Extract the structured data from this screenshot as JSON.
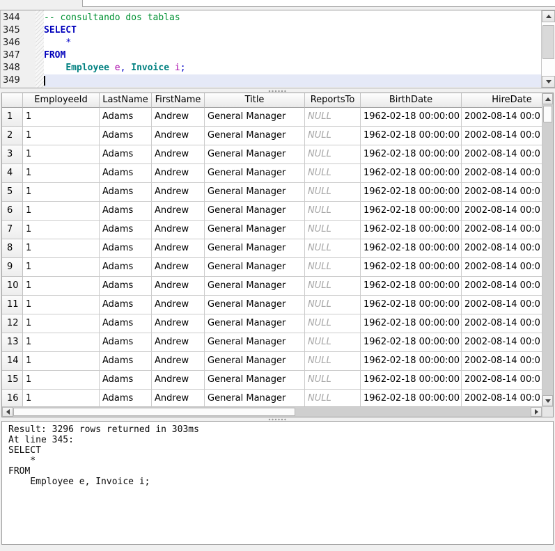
{
  "editor": {
    "lines": [
      {
        "number": "344",
        "tokens": [
          {
            "text": "-- consultando dos tablas",
            "type": "comment"
          }
        ]
      },
      {
        "number": "345",
        "tokens": [
          {
            "text": "SELECT",
            "type": "keyword"
          }
        ]
      },
      {
        "number": "346",
        "tokens": [
          {
            "text": "    ",
            "type": "plain"
          },
          {
            "text": "*",
            "type": "operator"
          }
        ]
      },
      {
        "number": "347",
        "tokens": [
          {
            "text": "FROM",
            "type": "keyword"
          }
        ]
      },
      {
        "number": "348",
        "tokens": [
          {
            "text": "    ",
            "type": "plain"
          },
          {
            "text": "Employee",
            "type": "table"
          },
          {
            "text": " ",
            "type": "plain"
          },
          {
            "text": "e",
            "type": "alias"
          },
          {
            "text": ",",
            "type": "operator"
          },
          {
            "text": " ",
            "type": "plain"
          },
          {
            "text": "Invoice",
            "type": "table"
          },
          {
            "text": " ",
            "type": "plain"
          },
          {
            "text": "i",
            "type": "alias"
          },
          {
            "text": ";",
            "type": "operator"
          }
        ]
      },
      {
        "number": "349",
        "tokens": [],
        "current": true,
        "cursor": true
      }
    ]
  },
  "results": {
    "columns": [
      "EmployeeId",
      "LastName",
      "FirstName",
      "Title",
      "ReportsTo",
      "BirthDate",
      "HireDate"
    ],
    "rows": [
      {
        "num": "1",
        "cells": [
          "1",
          "Adams",
          "Andrew",
          "General Manager",
          "NULL",
          "1962-02-18 00:00:00",
          "2002-08-14 00:0"
        ]
      },
      {
        "num": "2",
        "cells": [
          "1",
          "Adams",
          "Andrew",
          "General Manager",
          "NULL",
          "1962-02-18 00:00:00",
          "2002-08-14 00:0"
        ]
      },
      {
        "num": "3",
        "cells": [
          "1",
          "Adams",
          "Andrew",
          "General Manager",
          "NULL",
          "1962-02-18 00:00:00",
          "2002-08-14 00:0"
        ]
      },
      {
        "num": "4",
        "cells": [
          "1",
          "Adams",
          "Andrew",
          "General Manager",
          "NULL",
          "1962-02-18 00:00:00",
          "2002-08-14 00:0"
        ]
      },
      {
        "num": "5",
        "cells": [
          "1",
          "Adams",
          "Andrew",
          "General Manager",
          "NULL",
          "1962-02-18 00:00:00",
          "2002-08-14 00:0"
        ]
      },
      {
        "num": "6",
        "cells": [
          "1",
          "Adams",
          "Andrew",
          "General Manager",
          "NULL",
          "1962-02-18 00:00:00",
          "2002-08-14 00:0"
        ]
      },
      {
        "num": "7",
        "cells": [
          "1",
          "Adams",
          "Andrew",
          "General Manager",
          "NULL",
          "1962-02-18 00:00:00",
          "2002-08-14 00:0"
        ]
      },
      {
        "num": "8",
        "cells": [
          "1",
          "Adams",
          "Andrew",
          "General Manager",
          "NULL",
          "1962-02-18 00:00:00",
          "2002-08-14 00:0"
        ]
      },
      {
        "num": "9",
        "cells": [
          "1",
          "Adams",
          "Andrew",
          "General Manager",
          "NULL",
          "1962-02-18 00:00:00",
          "2002-08-14 00:0"
        ]
      },
      {
        "num": "10",
        "cells": [
          "1",
          "Adams",
          "Andrew",
          "General Manager",
          "NULL",
          "1962-02-18 00:00:00",
          "2002-08-14 00:0"
        ]
      },
      {
        "num": "11",
        "cells": [
          "1",
          "Adams",
          "Andrew",
          "General Manager",
          "NULL",
          "1962-02-18 00:00:00",
          "2002-08-14 00:0"
        ]
      },
      {
        "num": "12",
        "cells": [
          "1",
          "Adams",
          "Andrew",
          "General Manager",
          "NULL",
          "1962-02-18 00:00:00",
          "2002-08-14 00:0"
        ]
      },
      {
        "num": "13",
        "cells": [
          "1",
          "Adams",
          "Andrew",
          "General Manager",
          "NULL",
          "1962-02-18 00:00:00",
          "2002-08-14 00:0"
        ]
      },
      {
        "num": "14",
        "cells": [
          "1",
          "Adams",
          "Andrew",
          "General Manager",
          "NULL",
          "1962-02-18 00:00:00",
          "2002-08-14 00:0"
        ]
      },
      {
        "num": "15",
        "cells": [
          "1",
          "Adams",
          "Andrew",
          "General Manager",
          "NULL",
          "1962-02-18 00:00:00",
          "2002-08-14 00:0"
        ]
      },
      {
        "num": "16",
        "cells": [
          "1",
          "Adams",
          "Andrew",
          "General Manager",
          "NULL",
          "1962-02-18 00:00:00",
          "2002-08-14 00:0"
        ]
      }
    ]
  },
  "output": {
    "lines": [
      "Result: 3296 rows returned in 303ms",
      "At line 345:",
      "SELECT",
      "    *",
      "FROM",
      "    Employee e, Invoice i;"
    ]
  },
  "colors": {
    "keyword": "#0000bb",
    "comment": "#009132",
    "table_name": "#008080",
    "alias": "#a800a8",
    "operator": "#0000c8",
    "null_value": "#a6a6a6",
    "current_line": "#e5e9f7"
  }
}
